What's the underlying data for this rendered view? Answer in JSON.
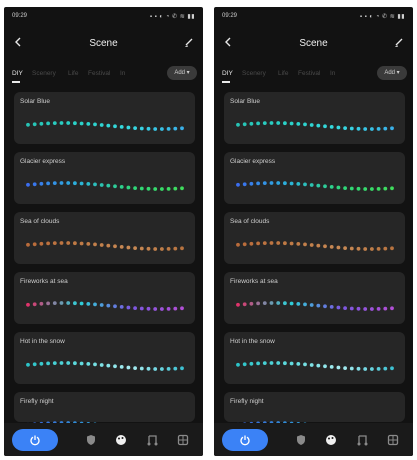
{
  "status_bar": {
    "time": "09:29",
    "icons": "▪ ▪ ◐ ◔ ✆ ≋ ▮▮"
  },
  "header": {
    "title": "Scene"
  },
  "tabs": [
    {
      "label": "DIY",
      "active": true
    },
    {
      "label": "Scenery"
    },
    {
      "label": "Life"
    },
    {
      "label": "Festival"
    },
    {
      "label": "In"
    }
  ],
  "add_button": {
    "label": "Add ▾"
  },
  "scenes": [
    {
      "name": "Solar Blue",
      "colors": [
        "#27c3b4",
        "#2ad1c8",
        "#36d9e0",
        "#3ab0e8"
      ]
    },
    {
      "name": "Glacier express",
      "colors": [
        "#3b6ef0",
        "#2bb3d9",
        "#2ed67a",
        "#3fdc5c"
      ]
    },
    {
      "name": "Sea of clouds",
      "colors": [
        "#b96b3a",
        "#c07a45",
        "#c88a55",
        "#b87440"
      ]
    },
    {
      "name": "Fireworks at sea",
      "colors": [
        "#e0336b",
        "#2cd2d8",
        "#7a58e0",
        "#b24fd6"
      ]
    },
    {
      "name": "Hot in the snow",
      "colors": [
        "#2cc4c8",
        "#5ed9dd",
        "#a8ecf0",
        "#3ec1d2"
      ]
    },
    {
      "name": "Firefly night",
      "colors": [
        "#3b62d9",
        "#2f8fd6",
        "#3fc1e0",
        "#3b62d9"
      ]
    }
  ],
  "nav": {
    "items": [
      {
        "icon": "power-icon",
        "active": true
      },
      {
        "icon": "shield-icon",
        "active": false
      },
      {
        "icon": "palette-icon",
        "active": false
      },
      {
        "icon": "music-icon",
        "active": false
      },
      {
        "icon": "grid-icon",
        "active": false
      }
    ]
  },
  "colors": {
    "accent": "#3b82f6",
    "background": "#121212",
    "card": "#262626"
  }
}
